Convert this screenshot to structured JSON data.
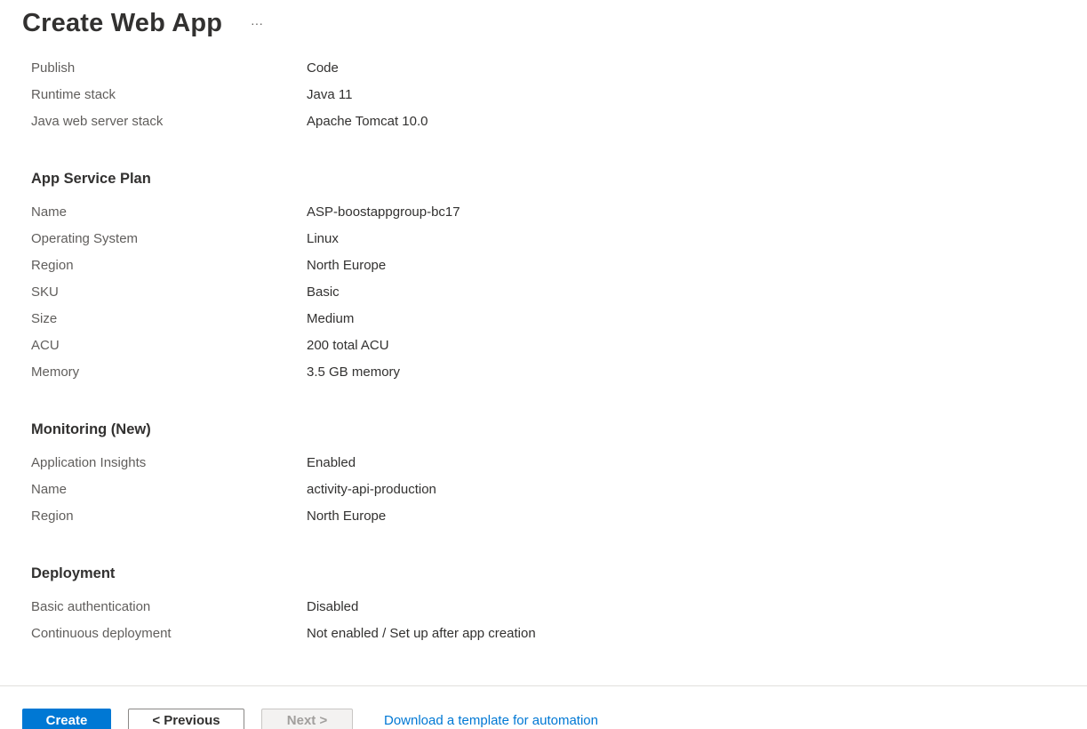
{
  "header": {
    "title": "Create Web App",
    "more_label": "···"
  },
  "app": {
    "rows": [
      {
        "label": "Publish",
        "value": "Code"
      },
      {
        "label": "Runtime stack",
        "value": "Java 11"
      },
      {
        "label": "Java web server stack",
        "value": "Apache Tomcat 10.0"
      }
    ]
  },
  "plan": {
    "heading": "App Service Plan",
    "rows": [
      {
        "label": "Name",
        "value": "ASP-boostappgroup-bc17"
      },
      {
        "label": "Operating System",
        "value": "Linux"
      },
      {
        "label": "Region",
        "value": "North Europe"
      },
      {
        "label": "SKU",
        "value": "Basic"
      },
      {
        "label": "Size",
        "value": "Medium"
      },
      {
        "label": "ACU",
        "value": "200 total ACU"
      },
      {
        "label": "Memory",
        "value": "3.5 GB memory"
      }
    ]
  },
  "monitoring": {
    "heading": "Monitoring (New)",
    "rows": [
      {
        "label": "Application Insights",
        "value": "Enabled"
      },
      {
        "label": "Name",
        "value": "activity-api-production"
      },
      {
        "label": "Region",
        "value": "North Europe"
      }
    ]
  },
  "deployment": {
    "heading": "Deployment",
    "rows": [
      {
        "label": "Basic authentication",
        "value": "Disabled"
      },
      {
        "label": "Continuous deployment",
        "value": "Not enabled / Set up after app creation"
      }
    ]
  },
  "footer": {
    "create_label": "Create",
    "previous_label": "< Previous",
    "next_label": "Next >",
    "template_link": "Download a template for automation"
  },
  "colors": {
    "accent": "#0078d4",
    "label_text": "#605e5c",
    "value_text": "#323130"
  }
}
